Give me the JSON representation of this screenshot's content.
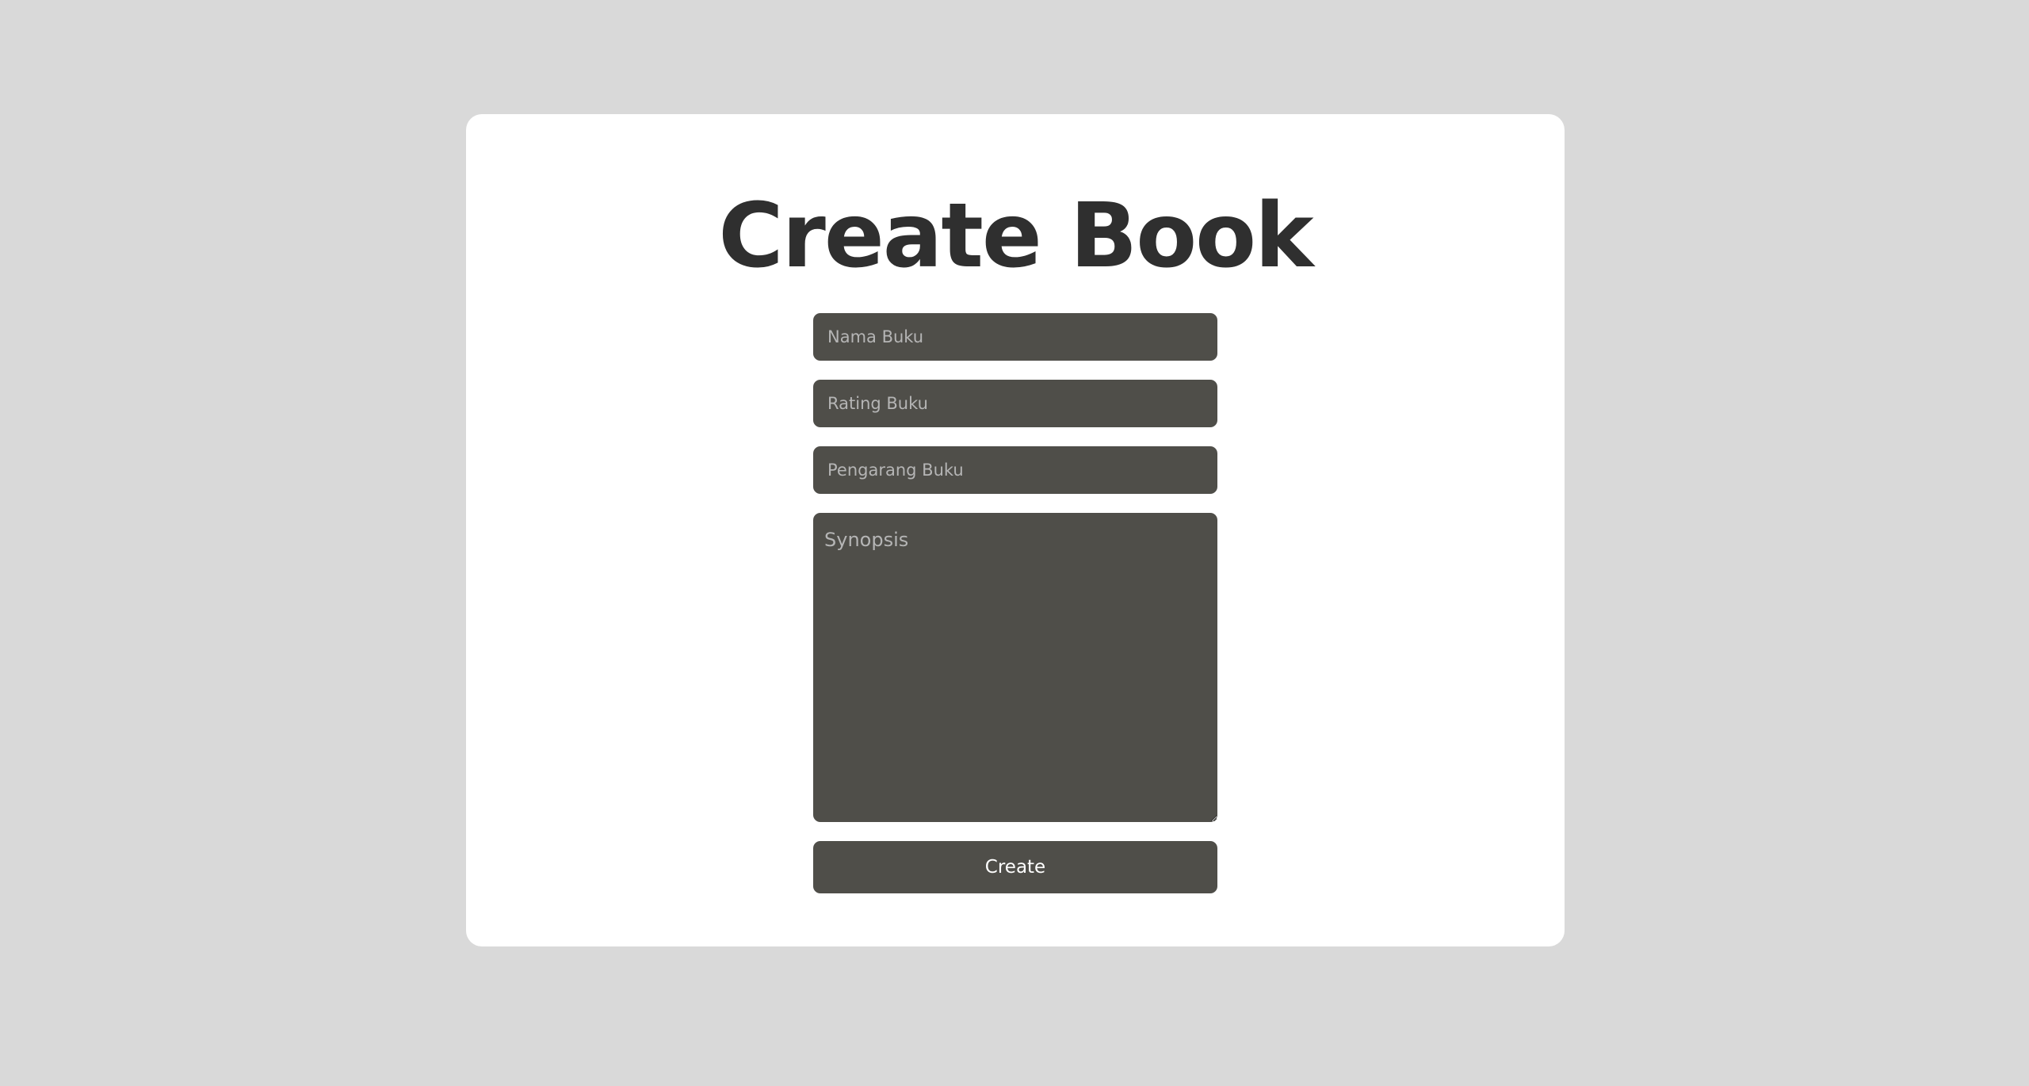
{
  "page": {
    "title": "Create Book"
  },
  "form": {
    "book_name": {
      "placeholder": "Nama Buku",
      "value": ""
    },
    "book_rating": {
      "placeholder": "Rating Buku",
      "value": ""
    },
    "book_author": {
      "placeholder": "Pengarang Buku",
      "value": ""
    },
    "synopsis": {
      "placeholder": "Synopsis",
      "value": ""
    },
    "submit_label": "Create"
  },
  "colors": {
    "background": "#d9d9d9",
    "card": "#ffffff",
    "title_text": "#2f2f2f",
    "field_background": "#4f4e49",
    "placeholder_text": "#b5b5b5",
    "button_text": "#ffffff"
  }
}
